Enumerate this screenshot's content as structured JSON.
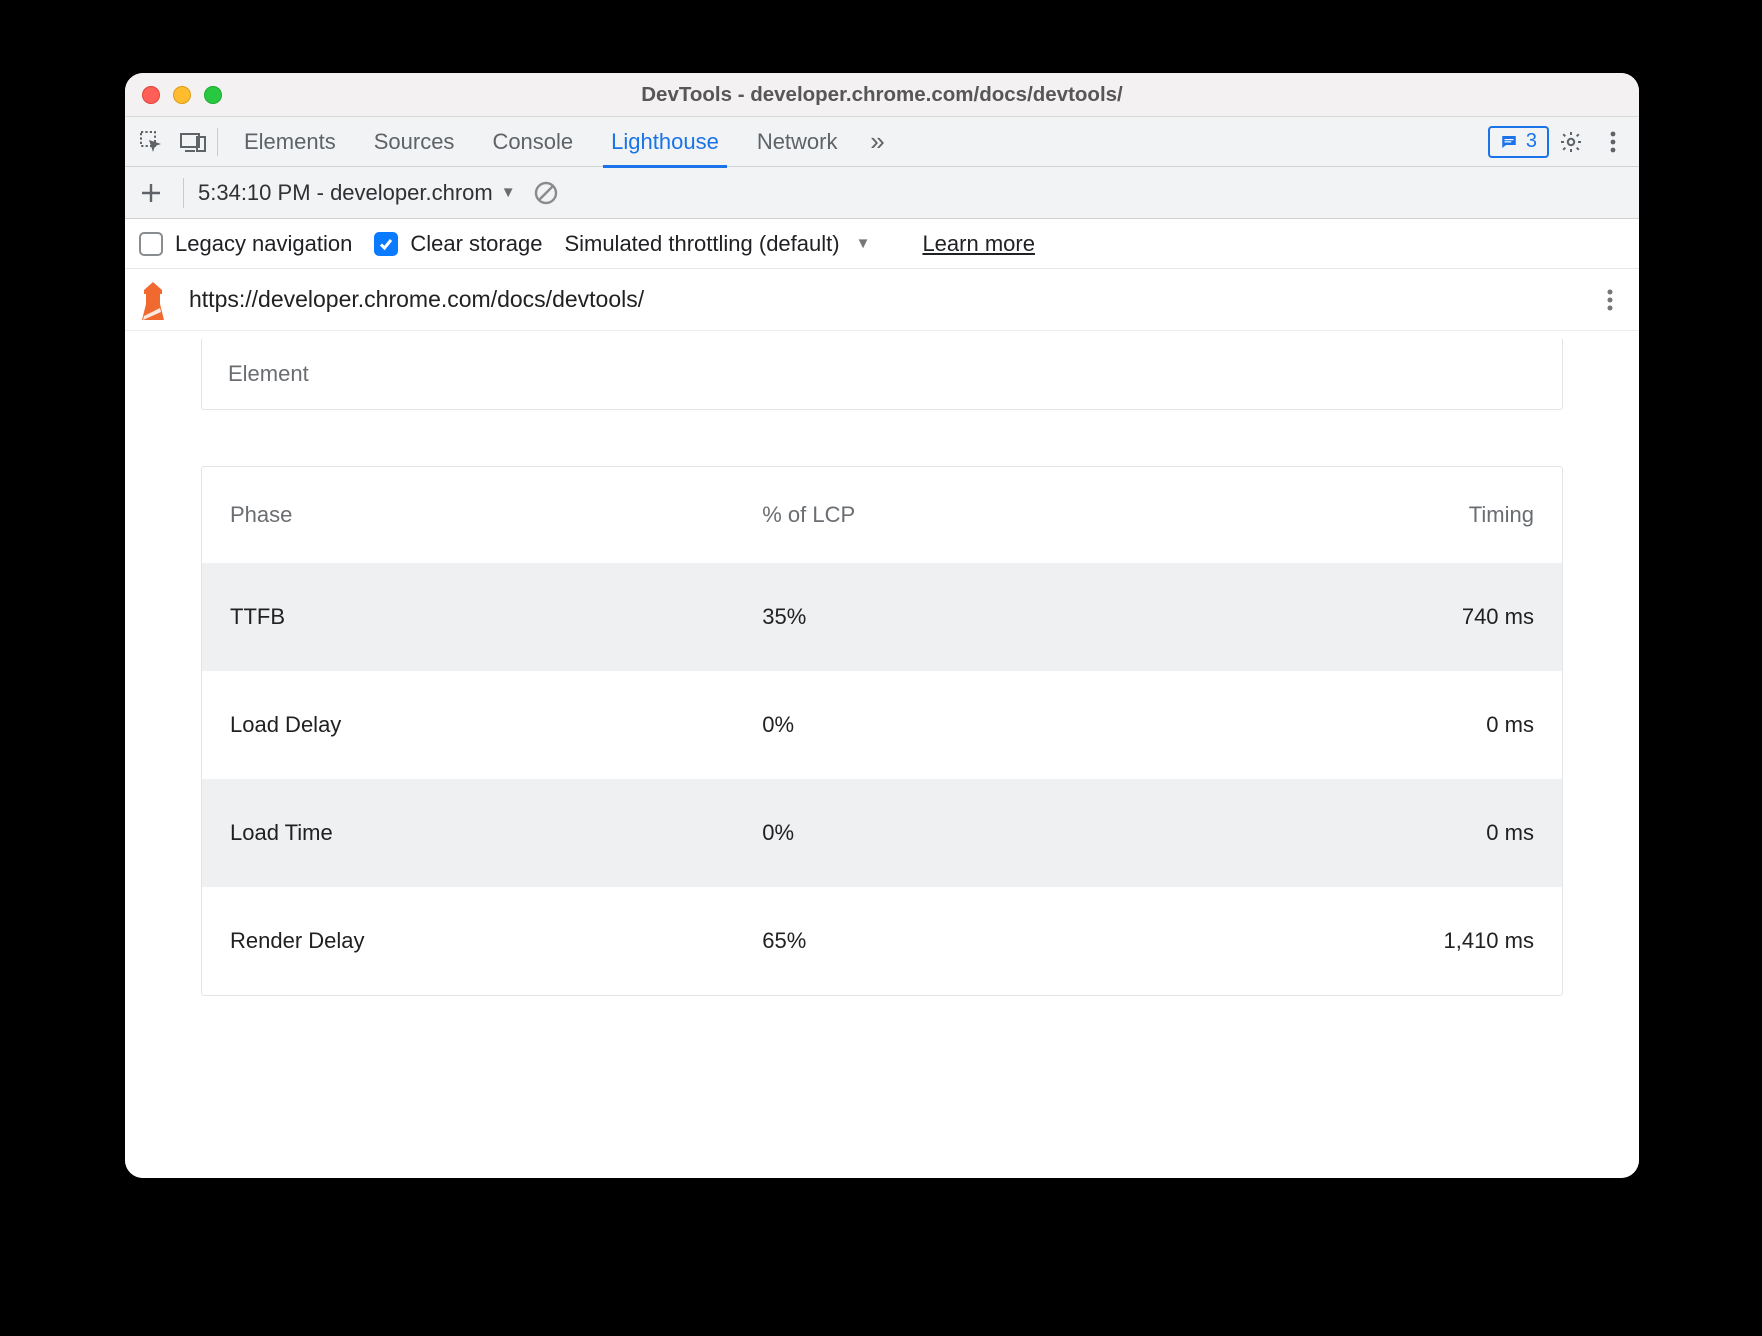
{
  "window": {
    "title": "DevTools - developer.chrome.com/docs/devtools/"
  },
  "tabs": {
    "items": [
      "Elements",
      "Sources",
      "Console",
      "Lighthouse",
      "Network"
    ],
    "activeIndex": 3,
    "more_glyph": "»"
  },
  "status": {
    "message_count": "3"
  },
  "lighthouse": {
    "toolbar": {
      "report_label": "5:34:10 PM - developer.chrom"
    },
    "settings": {
      "legacy_label": "Legacy navigation",
      "legacy_checked": false,
      "clear_label": "Clear storage",
      "clear_checked": true,
      "throttling_label": "Simulated throttling (default)",
      "learn_more": "Learn more"
    },
    "url": "https://developer.chrome.com/docs/devtools/",
    "element_card_label": "Element",
    "table": {
      "headers": {
        "phase": "Phase",
        "pct": "% of LCP",
        "timing": "Timing"
      },
      "rows": [
        {
          "phase": "TTFB",
          "pct": "35%",
          "timing": "740 ms"
        },
        {
          "phase": "Load Delay",
          "pct": "0%",
          "timing": "0 ms"
        },
        {
          "phase": "Load Time",
          "pct": "0%",
          "timing": "0 ms"
        },
        {
          "phase": "Render Delay",
          "pct": "65%",
          "timing": "1,410 ms"
        }
      ]
    }
  }
}
